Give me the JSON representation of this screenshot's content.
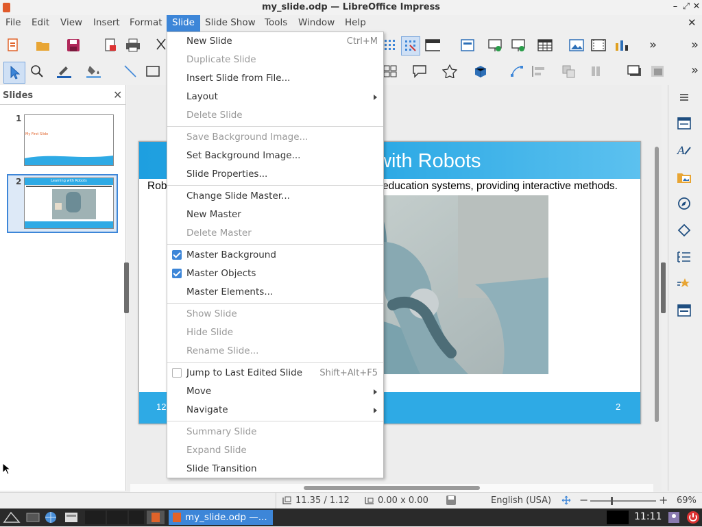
{
  "window": {
    "title": "my_slide.odp — LibreOffice Impress"
  },
  "menubar": [
    "File",
    "Edit",
    "View",
    "Insert",
    "Format",
    "Slide",
    "Slide Show",
    "Tools",
    "Window",
    "Help"
  ],
  "slides_pane": {
    "header": "Slides",
    "thumbs": [
      {
        "num": "1",
        "text": "My First Slide"
      },
      {
        "num": "2",
        "text": "Learning with Robots"
      }
    ]
  },
  "slide": {
    "title_visible": "with Robots",
    "body_left": "Rob",
    "body_right": "education systems, providing interactive methods.",
    "footer_left": "12",
    "footer_right": "2"
  },
  "slide_menu": {
    "items": [
      {
        "label": "New Slide",
        "shortcut": "Ctrl+M",
        "enabled": true
      },
      {
        "label": "Duplicate Slide",
        "enabled": false
      },
      {
        "label": "Insert Slide from File...",
        "enabled": true
      },
      {
        "label": "Layout",
        "enabled": true,
        "submenu": true
      },
      {
        "label": "Delete Slide",
        "enabled": false
      },
      {
        "label": "Save Background Image...",
        "enabled": false
      },
      {
        "label": "Set Background Image...",
        "enabled": true
      },
      {
        "label": "Slide Properties...",
        "enabled": true
      },
      {
        "label": "Change Slide Master...",
        "enabled": true
      },
      {
        "label": "New Master",
        "enabled": true
      },
      {
        "label": "Delete Master",
        "enabled": false
      },
      {
        "label": "Master Background",
        "enabled": true,
        "checked": true
      },
      {
        "label": "Master Objects",
        "enabled": true,
        "checked": true
      },
      {
        "label": "Master Elements...",
        "enabled": true
      },
      {
        "label": "Show Slide",
        "enabled": false
      },
      {
        "label": "Hide Slide",
        "enabled": false
      },
      {
        "label": "Rename Slide...",
        "enabled": false
      },
      {
        "label": "Jump to Last Edited Slide",
        "shortcut": "Shift+Alt+F5",
        "enabled": true,
        "checked": false
      },
      {
        "label": "Move",
        "enabled": true,
        "submenu": true
      },
      {
        "label": "Navigate",
        "enabled": true,
        "submenu": true
      },
      {
        "label": "Summary Slide",
        "enabled": false
      },
      {
        "label": "Expand Slide",
        "enabled": false
      },
      {
        "label": "Slide Transition",
        "enabled": true
      }
    ]
  },
  "statusbar": {
    "position": "11.35 / 1.12",
    "size": "0.00 x 0.00",
    "language": "English (USA)",
    "zoom": "69%"
  },
  "taskbar": {
    "window_label": "my_slide.odp —...",
    "clock": "11:11"
  },
  "colors": {
    "accent": "#3d86d8",
    "slide_blue": "#2eaae5"
  }
}
